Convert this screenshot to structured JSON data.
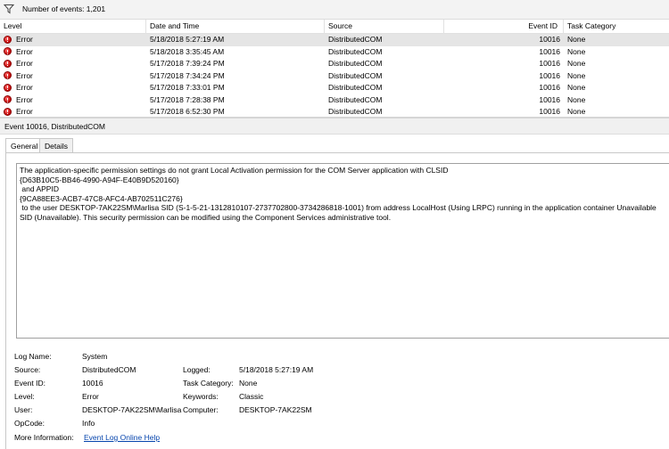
{
  "filter_bar": {
    "event_count_text": "Number of events: 1,201"
  },
  "columns": [
    "Level",
    "Date and Time",
    "Source",
    "Event ID",
    "Task Category"
  ],
  "events": [
    {
      "level": "Error",
      "datetime": "5/18/2018 5:27:19 AM",
      "source": "DistributedCOM",
      "event_id": "10016",
      "category": "None"
    },
    {
      "level": "Error",
      "datetime": "5/18/2018 3:35:45 AM",
      "source": "DistributedCOM",
      "event_id": "10016",
      "category": "None"
    },
    {
      "level": "Error",
      "datetime": "5/17/2018 7:39:24 PM",
      "source": "DistributedCOM",
      "event_id": "10016",
      "category": "None"
    },
    {
      "level": "Error",
      "datetime": "5/17/2018 7:34:24 PM",
      "source": "DistributedCOM",
      "event_id": "10016",
      "category": "None"
    },
    {
      "level": "Error",
      "datetime": "5/17/2018 7:33:01 PM",
      "source": "DistributedCOM",
      "event_id": "10016",
      "category": "None"
    },
    {
      "level": "Error",
      "datetime": "5/17/2018 7:28:38 PM",
      "source": "DistributedCOM",
      "event_id": "10016",
      "category": "None"
    },
    {
      "level": "Error",
      "datetime": "5/17/2018 6:52:30 PM",
      "source": "DistributedCOM",
      "event_id": "10016",
      "category": "None"
    }
  ],
  "detail": {
    "title": "Event 10016, DistributedCOM",
    "tabs": [
      "General",
      "Details"
    ],
    "message": "The application-specific permission settings do not grant Local Activation permission for the COM Server application with CLSID\n{D63B10C5-BB46-4990-A94F-E40B9D520160}\n and APPID\n{9CA88EE3-ACB7-47C8-AFC4-AB702511C276}\n to the user DESKTOP-7AK22SM\\Marlisa SID (S-1-5-21-1312810107-2737702800-3734286818-1001) from address LocalHost (Using LRPC) running in the application container Unavailable SID (Unavailable). This security permission can be modified using the Component Services administrative tool.",
    "props": {
      "log_name_label": "Log Name:",
      "log_name": "System",
      "source_label": "Source:",
      "source": "DistributedCOM",
      "logged_label": "Logged:",
      "logged": "5/18/2018 5:27:19 AM",
      "event_id_label": "Event ID:",
      "event_id": "10016",
      "task_category_label": "Task Category:",
      "task_category": "None",
      "level_label": "Level:",
      "level": "Error",
      "keywords_label": "Keywords:",
      "keywords": "Classic",
      "user_label": "User:",
      "user": "DESKTOP-7AK22SM\\Marlisa",
      "computer_label": "Computer:",
      "computer": "DESKTOP-7AK22SM",
      "opcode_label": "OpCode:",
      "opcode": "Info",
      "more_info_label": "More Information:",
      "more_info_link": "Event Log Online Help"
    }
  }
}
